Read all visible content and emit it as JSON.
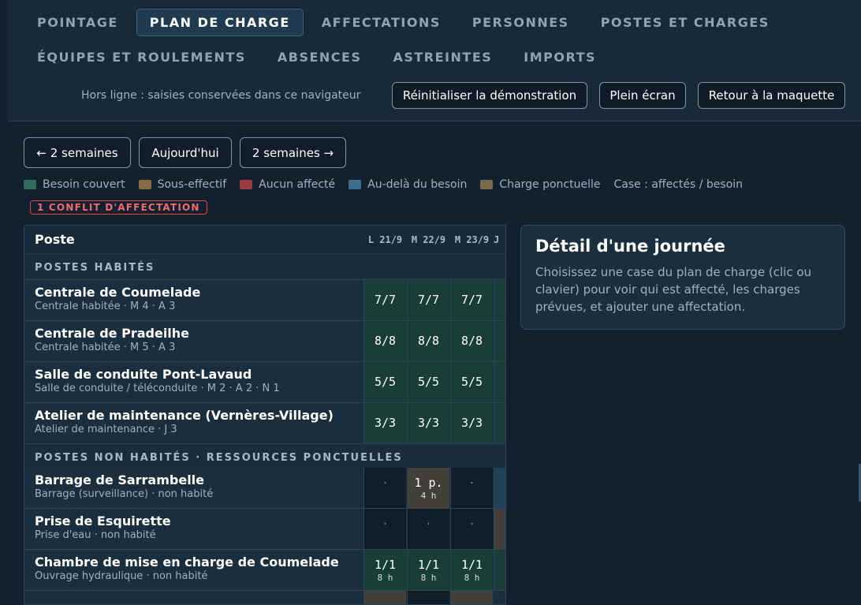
{
  "nav": {
    "tabs": [
      "POINTAGE",
      "PLAN DE CHARGE",
      "AFFECTATIONS",
      "PERSONNES",
      "POSTES ET CHARGES"
    ],
    "tabs_row2": [
      "ÉQUIPES ET ROULEMENTS",
      "ABSENCES",
      "ASTREINTES",
      "IMPORTS"
    ],
    "active_tab": "PLAN DE CHARGE"
  },
  "toolbar": {
    "status": "Hors ligne : saisies conservées dans ce navigateur",
    "reset_label": "Réinitialiser la démonstration",
    "fullscreen_label": "Plein écran",
    "back_label": "Retour à la maquette"
  },
  "week_nav": {
    "prev_label": "← 2 semaines",
    "today_label": "Aujourd'hui",
    "next_label": "2 semaines →"
  },
  "legend": {
    "items": [
      {
        "label": "Besoin couvert",
        "color": "#2f6e5b"
      },
      {
        "label": "Sous-effectif",
        "color": "#8a6a44"
      },
      {
        "label": "Aucun affecté",
        "color": "#9e3b40"
      },
      {
        "label": "Au-delà du besoin",
        "color": "#3d6e8c"
      },
      {
        "label": "Charge ponctuelle",
        "color": "#7d6a4c"
      }
    ],
    "note": "Case : affectés / besoin"
  },
  "conflict_badge": "1 CONFLIT D'AFFECTATION",
  "grid": {
    "header": {
      "poste": "Poste",
      "days": [
        "L 21/9",
        "M 22/9",
        "M 23/9",
        "J"
      ]
    },
    "sections": [
      {
        "title": "POSTES HABITÉS",
        "rows": [
          {
            "name": "Centrale de Coumelade",
            "meta": "Centrale habitée · M 4 · A 3",
            "cells": [
              {
                "v": "7/7"
              },
              {
                "v": "7/7"
              },
              {
                "v": "7/7"
              }
            ]
          },
          {
            "name": "Centrale de Pradeilhe",
            "meta": "Centrale habitée · M 5 · A 3",
            "cells": [
              {
                "v": "8/8"
              },
              {
                "v": "8/8"
              },
              {
                "v": "8/8"
              }
            ]
          },
          {
            "name": "Salle de conduite Pont-Lavaud",
            "meta": "Salle de conduite / téléconduite · M 2 · A 2 · N 1",
            "cells": [
              {
                "v": "5/5"
              },
              {
                "v": "5/5"
              },
              {
                "v": "5/5"
              }
            ]
          },
          {
            "name": "Atelier de maintenance (Vernères-Village)",
            "meta": "Atelier de maintenance · J 3",
            "cells": [
              {
                "v": "3/3"
              },
              {
                "v": "3/3"
              },
              {
                "v": "3/3"
              }
            ]
          }
        ]
      },
      {
        "title": "POSTES NON HABITÉS · RESSOURCES PONCTUELLES",
        "rows": [
          {
            "name": "Barrage de Sarrambelle",
            "meta": "Barrage (surveillance) · non habité",
            "cells": [
              {
                "v": "·"
              },
              {
                "v": "1 p.",
                "h": "4 h"
              },
              {
                "v": "·"
              }
            ]
          },
          {
            "name": "Prise de Esquirette",
            "meta": "Prise d'eau · non habité",
            "cells": [
              {
                "v": "·"
              },
              {
                "v": "·"
              },
              {
                "v": "·"
              }
            ]
          },
          {
            "name": "Chambre de mise en charge de Coumelade",
            "meta": "Ouvrage hydraulique · non habité",
            "cells": [
              {
                "v": "1/1",
                "h": "8 h"
              },
              {
                "v": "1/1",
                "h": "8 h"
              },
              {
                "v": "1/1",
                "h": "8 h"
              }
            ]
          }
        ]
      }
    ]
  },
  "detail": {
    "title": "Détail d'une journée",
    "text": "Choisissez une case du plan de charge (clic ou clavier) pour voir qui est affecté, les charges prévues, et ajouter une affectation."
  }
}
